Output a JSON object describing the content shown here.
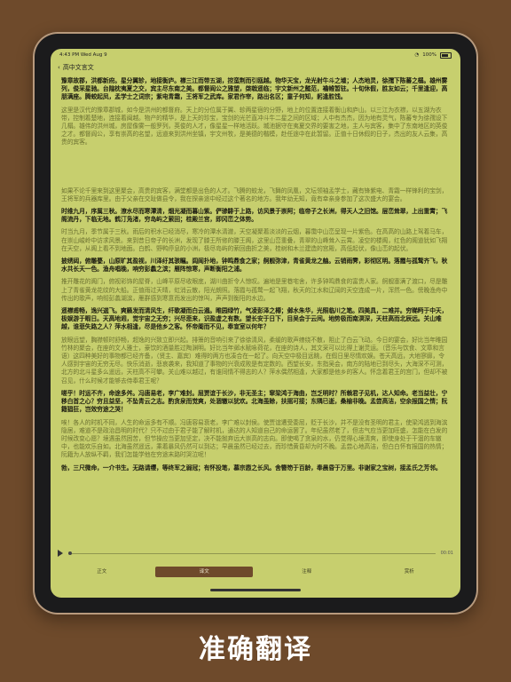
{
  "status": {
    "time": "4:43 PM",
    "date": "Wed Aug 9",
    "battery": "100%"
  },
  "nav": {
    "back_label": "高中文言文"
  },
  "sections": [
    {
      "original": "豫章故郡，洪都新府。星分翼轸，地接衡庐。襟三江而带五湖，控蛮荆而引瓯越。物华天宝，龙光射牛斗之墟；人杰地灵，徐孺下陈蕃之榻。雄州雾列，俊采星驰。台隍枕夷夏之交，宾主尽东南之美。都督阎公之雅望，棨戟遥临；宇文新州之懿范，襜帷暂驻。十旬休假，胜友如云；千里逢迎，高朋满座。腾蛟起凤，孟学士之词宗；紫电青霜，王将军之武库。家君作宰，路出名区；童子何知，躬逢胜饯。",
      "translation": "这里是汉代的豫章郡城，如今是洪州的都督府。天上的分位属于翼、轸两星宿的分野，地上的位置连接着衡山和庐山。以三江为衣襟，以五湖为衣带，控制着楚地，连接着闽越。物产的精华，是上天的珍宝，宝剑的光芒直冲斗牛二星之间的区域；人中有杰杰，因为地有灵气，陈蕃专为徐孺设下几榻。雄伟的洪州城，房屋像雾一般罗列，英俊的人才，像星星一样地活跃。城池据守在夷夏交界的要害之地，主人与宾客，集中了东南地区的英俊之才。都督阎公，享有崇高的名望，远道来到洪州坐镇，宇文州牧，是美德的楷模，赴任途中在此暂留。正值十日休假的日子，杰出的友人云集，高贵的宾客。"
    },
    {
      "original": "",
      "translation": "如果不论千里来到这里聚会，高贵的宾客，满堂都是出色的人才。飞腾的蛟龙，飞舞的凤凰，文坛领袖孟学士，藏有锋紫电、青霜一样锋利的宝剑，王将军的兵器库里。由于父亲在交趾做县令，我在探亲途中经过这个著名的地方。我年幼无知，竟有幸亲身参加了这次盛大的宴会。"
    },
    {
      "original": "时维九月，序属三秋。潦水尽而寒潭清，烟光凝而暮山紫。俨骖騑于上路，访风景于崇阿；临帝子之长洲，得天人之旧馆。层峦耸翠，上出重霄；飞阁流丹，下临无地。鹤汀凫渚，穷岛屿之萦回；桂殿兰宫，即冈峦之体势。",
      "translation": "时当九月，季节属于三秋。雨后的积水已经消尽，寒冷的潭水清澈，天空凝聚着淡淡的云烟，暮霭中山峦呈现一片紫色。在高高的山路上驾着马车，在崇山峻岭中访求风景。来到昔日帝子的长洲，发现了滕王所修的滕王阁，这里山峦重叠，青翠的山峰耸入云霄。凌空的楼阁，红色的阁道犹如飞翔在天空，从阁上看不到地面。白鹤、野鸭停息的小洲，极尽岛屿的萦回曲折之美，桂树和木兰建造的宫殿，高低起伏，像山峦的起伏。"
    },
    {
      "original": "披绣闼，俯雕甍，山原旷其盈视，川泽纡其骇瞩。闾阎扑地，钟鸣鼎食之家；舸舰弥津，青雀黄龙之舳。云销雨霁，彩彻区明。落霞与孤鹜齐飞，秋水共长天一色。渔舟唱晚，响穷彭蠡之滨；雁阵惊寒，声断衡阳之浦。",
      "translation": "推开雕花的阁门，俯视彩饰的屋脊，山峰平原尽收眼底，湖川曲折令人惊叹。遍地是里巷宅舍，许多钟鸣鼎食的富贵人家。舸舰塞满了渡口，尽是雕上了青雀黄龙花纹的大船。正值雨过天晴，虹消云散，阳光朗照。落霞与孤鹜一起飞翔，秋天的江水和辽阔的天空连成一片，浑然一色。傍晚渔舟中传出的歌声，响彻彭蠡湖滨，雁群感到寒意而发出的惊叫，声声到衡阳的水边。"
    },
    {
      "original": "遥襟甫畅，逸兴遄飞。爽籁发而清风生，纤歌凝而白云遏。睢园绿竹，气凌彭泽之樽；邺水朱华，光照临川之笔。四美具，二难并。穷睇眄于中天，极娱游于暇日。天高地迥，觉宇宙之无穷；兴尽悲来，识盈虚之有数。望长安于日下，目吴会于云间。地势极而南溟深，天柱高而北辰远。关山难越，谁悲失路之人？萍水相逢，尽是他乡之客。怀帝阍而不见，奉宣室以何年？",
      "translation": "放眼远望，胸襟顿时舒畅，超逸的兴致立即兴起。排箫的音响引来了徐徐清风，柔缓的歌声缭绕不散，阻止了白云飞动。今日的宴会，好比当年睢园竹林的聚会，在座的文人雅士，豪饮的酒量胜过陶渊明。好比当年邺水赋咏荷花，在座的诗人，其文采可以比得上谢灵运。（音乐与饮食、文章和言语）这四种美好的事物都已经齐备，（贤主、嘉宾）难得的两方也凑合在一起了。向天空中极目远眺，在假日里尽情欢娱。苍天高远，大地寥廓，令人感到宇宙的无穷无尽。快乐消逝，悲哀袭来，我知道了事物的兴衰成败是有定数的。西望长安，东指吴会，南方的陆地已到尽头，大海深不可测，北方的北斗星多么遥远，天柱高不可攀。关山难以越过，有谁同情不得志的人？萍水偶然相逢，大家都是他乡的客人。怀念着君王的宫门，但却不被召见，什么时候才能够去侍奉君王呢？"
    },
    {
      "original": "嗟乎！时运不齐，命途多舛。冯唐易老，李广难封。屈贾谊于长沙，非无圣主；窜梁鸿于海曲，岂乏明时？所赖君子见机，达人知命。老当益壮，宁移白首之心？穷且益坚，不坠青云之志。酌贪泉而觉爽，处涸辙以犹欢。北海虽赊，扶摇可接；东隅已逝，桑榆非晚。孟尝高洁，空余报国之情；阮籍猖狂，岂效穷途之哭！",
      "translation": "唉！各人的时机不同，人生的命运多有不顺。冯唐容易衰老，李广难以封侯。使贾谊遭受委屈，贬于长沙，并不是没有圣明的君主，使梁鸿逃到海滨隐居，难道不是政治昌明的时代？只不过由于君子能了解时机，通达的人知道自己的命运罢了。年纪虽然老了，但志气应当更加旺盛，怎能在白发的时候改变心愿？境遇虽然困苦，但节操应当更加坚定，决不能抛弃远大崇高的志向。即使喝了贪泉的水，仍觉得心境清爽，即使身处于干涸的车辙中，也能欢乐自如。北海虽然遥远，乘着暴风仍然可以到达；早晨虽然已经过去，而珍惜黄昏却为时不晚。孟尝心地高洁，但白白怀有报国的热情；阮籍为人放纵不羁，我们怎能学他在穷途末路时哭泣呢！"
    },
    {
      "original": "勃，三尺微命，一介书生。无路请缨，等终军之弱冠；有怀投笔，慕宗悫之长风。舍簪笏于百龄，奉晨昏于万里。非谢家之宝树，接孟氏之芳邻。",
      "translation": ""
    }
  ],
  "player": {
    "time": "00:01"
  },
  "tabs": [
    "正文",
    "译文",
    "注释",
    "赏析"
  ],
  "active_tab": 1,
  "caption": "准确翻译"
}
